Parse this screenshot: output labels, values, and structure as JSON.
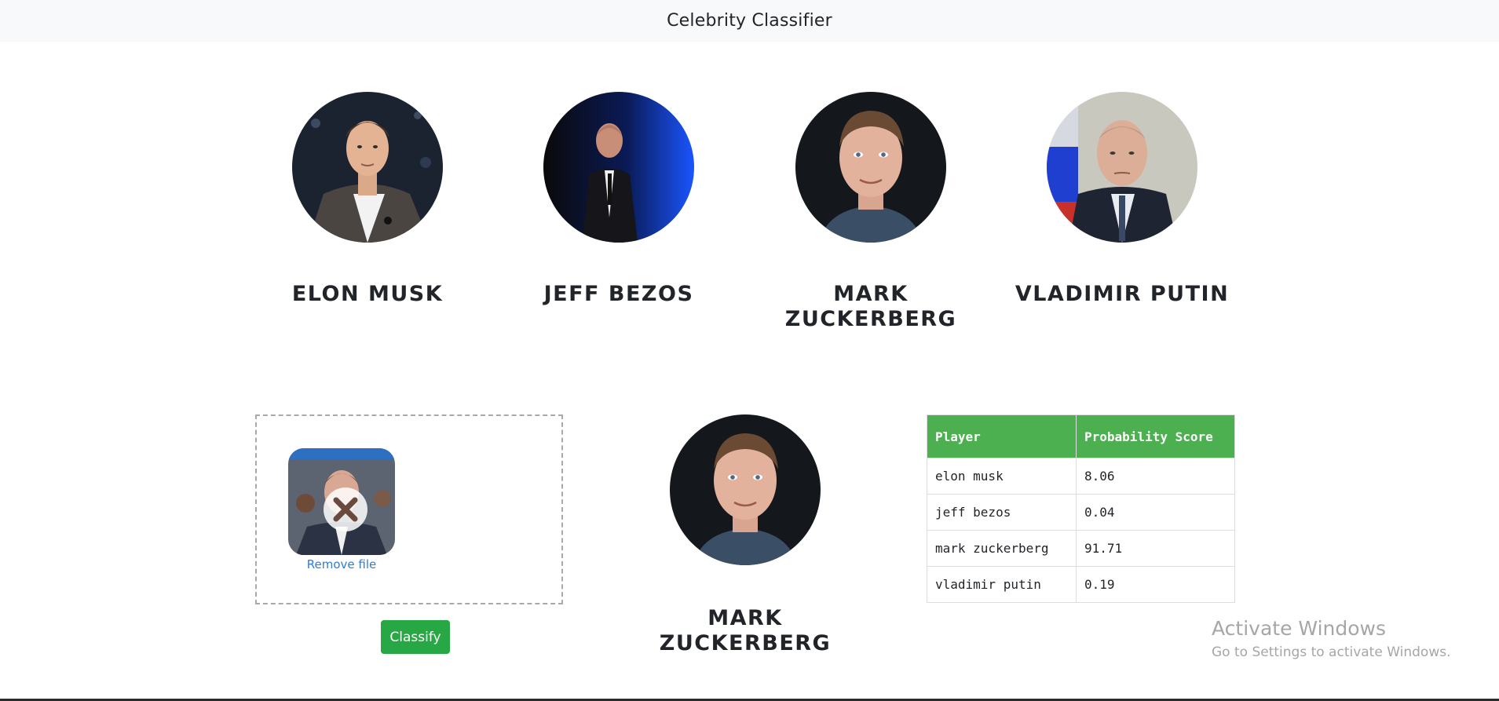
{
  "header": {
    "title": "Celebrity Classifier"
  },
  "celebrities": [
    {
      "name": "ELON MUSK",
      "image": "elon-musk-photo"
    },
    {
      "name": "JEFF BEZOS",
      "image": "jeff-bezos-photo"
    },
    {
      "name": "MARK ZUCKERBERG",
      "image": "mark-zuckerberg-photo"
    },
    {
      "name": "VLADIMIR PUTIN",
      "image": "vladimir-putin-photo"
    }
  ],
  "upload": {
    "remove_label": "Remove file",
    "remove_icon": "close-x-icon",
    "classify_label": "Classify"
  },
  "result": {
    "name": "MARK ZUCKERBERG",
    "image": "mark-zuckerberg-photo"
  },
  "scores": {
    "headers": [
      "Player",
      "Probability Score"
    ],
    "rows": [
      {
        "player": "elon musk",
        "score": "8.06"
      },
      {
        "player": "jeff bezos",
        "score": "0.04"
      },
      {
        "player": "mark zuckerberg",
        "score": "91.71"
      },
      {
        "player": "vladimir putin",
        "score": "0.19"
      }
    ]
  },
  "watermark": {
    "line1": "Activate Windows",
    "line2": "Go to Settings to activate Windows."
  },
  "colors": {
    "header_bg": "#f8f9fa",
    "table_header_bg": "#4caf50",
    "classify_button": "#28a745",
    "link": "#2e7dd7"
  }
}
